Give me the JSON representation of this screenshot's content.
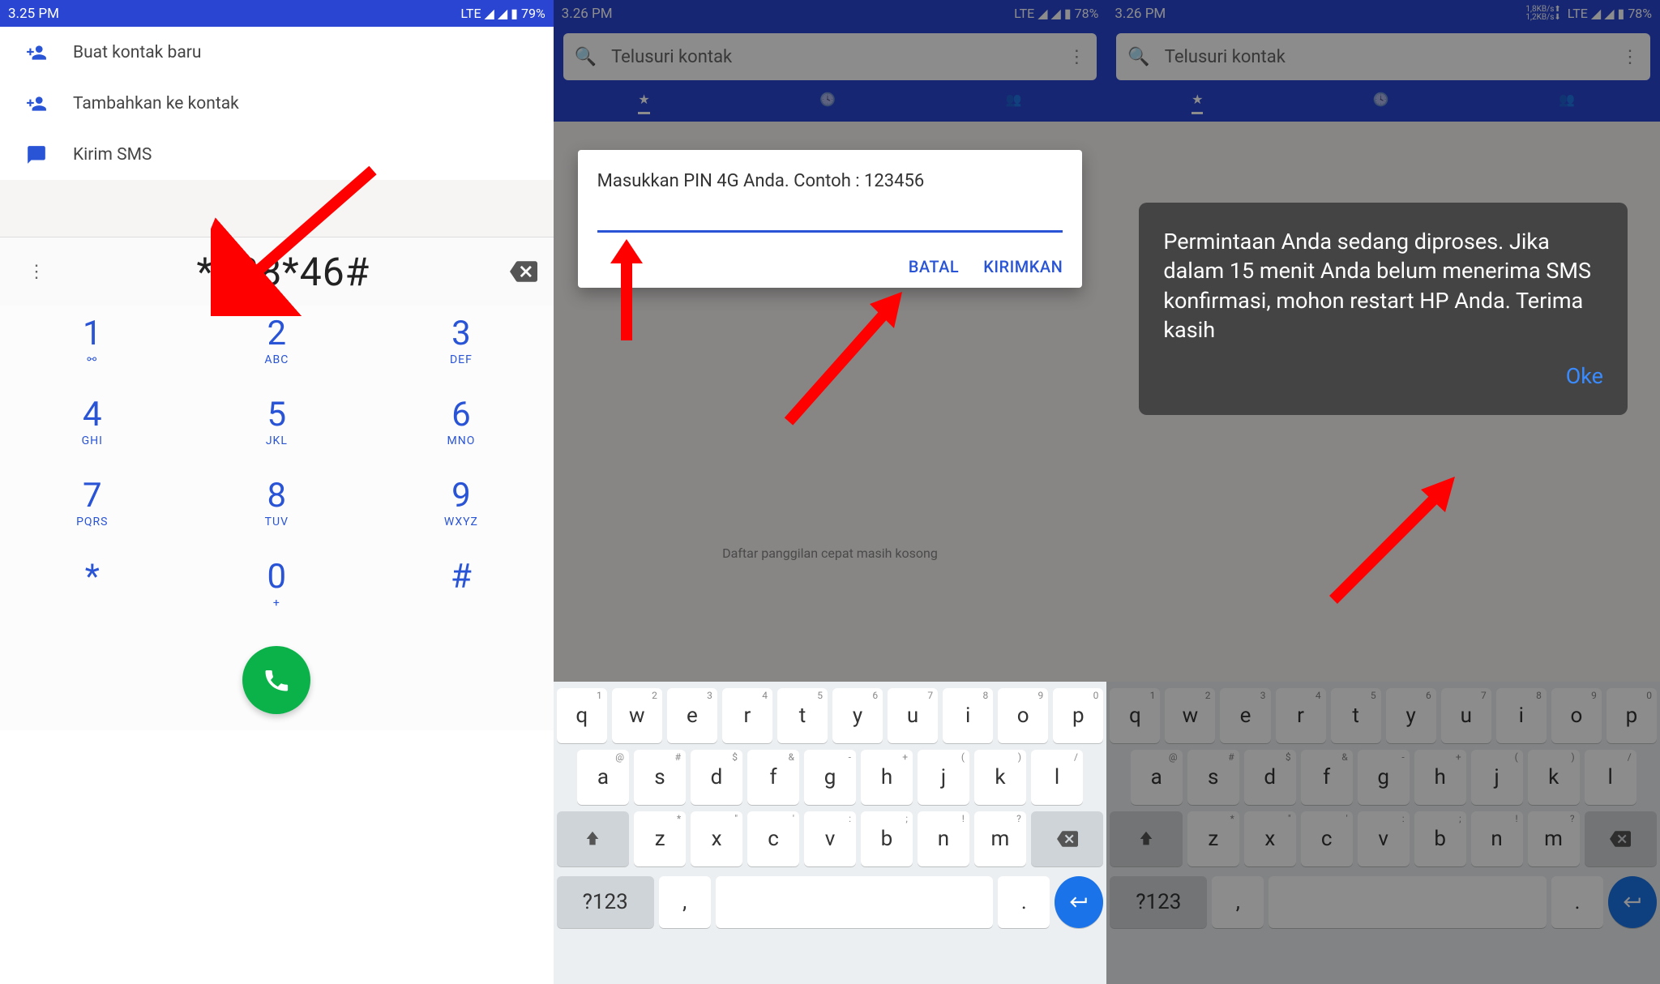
{
  "screen1": {
    "status": {
      "time": "3.25 PM",
      "network": "LTE",
      "battery": "79%"
    },
    "menu": {
      "create_contact": "Buat kontak baru",
      "add_to_contact": "Tambahkan ke kontak",
      "send_sms": "Kirim SMS"
    },
    "dialed_number": "*888*46#",
    "keypad": {
      "k1": {
        "d": "1",
        "l": "⚯"
      },
      "k2": {
        "d": "2",
        "l": "ABC"
      },
      "k3": {
        "d": "3",
        "l": "DEF"
      },
      "k4": {
        "d": "4",
        "l": "GHI"
      },
      "k5": {
        "d": "5",
        "l": "JKL"
      },
      "k6": {
        "d": "6",
        "l": "MNO"
      },
      "k7": {
        "d": "7",
        "l": "PQRS"
      },
      "k8": {
        "d": "8",
        "l": "TUV"
      },
      "k9": {
        "d": "9",
        "l": "WXYZ"
      },
      "ks": {
        "d": "*",
        "l": ""
      },
      "k0": {
        "d": "0",
        "l": "+"
      },
      "kh": {
        "d": "#",
        "l": ""
      }
    }
  },
  "screen2": {
    "status": {
      "time": "3.26 PM",
      "network": "LTE",
      "battery": "78%"
    },
    "search_placeholder": "Telusuri kontak",
    "dialog": {
      "message": "Masukkan PIN 4G Anda. Contoh : 123456",
      "cancel": "BATAL",
      "send": "KIRIMKAN"
    },
    "bg_empty": "Daftar panggilan cepat masih kosong"
  },
  "screen3": {
    "status": {
      "time": "3.26 PM",
      "network": "LTE",
      "battery": "78%",
      "net_up": "1,8KB/s",
      "net_down": "1,2KB/s"
    },
    "search_placeholder": "Telusuri kontak",
    "toast": {
      "message": "Permintaan Anda sedang diproses. Jika dalam 15 menit Anda belum menerima SMS konfirmasi, mohon restart HP Anda. Terima kasih",
      "ok": "Oke"
    }
  },
  "keyboard": {
    "row1": [
      {
        "k": "q",
        "s": "1"
      },
      {
        "k": "w",
        "s": "2"
      },
      {
        "k": "e",
        "s": "3"
      },
      {
        "k": "r",
        "s": "4"
      },
      {
        "k": "t",
        "s": "5"
      },
      {
        "k": "y",
        "s": "6"
      },
      {
        "k": "u",
        "s": "7"
      },
      {
        "k": "i",
        "s": "8"
      },
      {
        "k": "o",
        "s": "9"
      },
      {
        "k": "p",
        "s": "0"
      }
    ],
    "row2": [
      {
        "k": "a",
        "s": "@"
      },
      {
        "k": "s",
        "s": "#"
      },
      {
        "k": "d",
        "s": "$"
      },
      {
        "k": "f",
        "s": "&"
      },
      {
        "k": "g",
        "s": "-"
      },
      {
        "k": "h",
        "s": "+"
      },
      {
        "k": "j",
        "s": "("
      },
      {
        "k": "k",
        "s": ")"
      },
      {
        "k": "l",
        "s": "/"
      }
    ],
    "row3": [
      {
        "k": "z",
        "s": "*"
      },
      {
        "k": "x",
        "s": "\""
      },
      {
        "k": "c",
        "s": "'"
      },
      {
        "k": "v",
        "s": ":"
      },
      {
        "k": "b",
        "s": ";"
      },
      {
        "k": "n",
        "s": "!"
      },
      {
        "k": "m",
        "s": "?"
      }
    ],
    "symbol_key": "?123",
    "comma": ",",
    "period": "."
  }
}
